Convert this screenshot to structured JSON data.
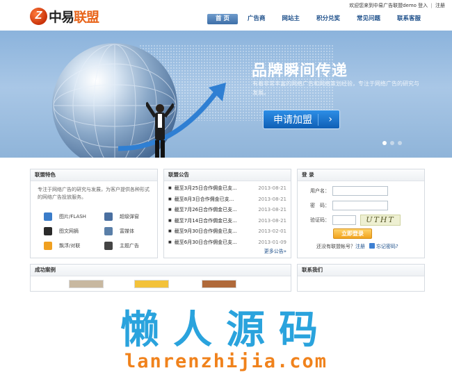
{
  "header": {
    "logo_glyph": "Z",
    "logo_text_black": "中易",
    "logo_text_orange": "联盟",
    "welcome": "欢迎您来到中易广告联盟demo",
    "login_link": "登入",
    "separator": "|",
    "register_link": "注册",
    "nav": [
      "首 页",
      "广告商",
      "网站主",
      "积分兑奖",
      "常见问题",
      "联系客服"
    ],
    "active_nav": 0
  },
  "banner": {
    "title": "品牌瞬间传递",
    "text": "有着非常丰富的网络广告和网络策划经验，专注于网络广告的研究与发展。",
    "button": "申请加盟",
    "button_chevron": "›",
    "slides": 3,
    "active_slide": 0
  },
  "features": {
    "title": "联盟特色",
    "description": "专注于网络广告的研究与发展，为客户提供各种形式的网络广告投放服务。",
    "items": [
      {
        "label": "图片/FLASH",
        "icon": "image-flash-icon",
        "color": "#3a7cc9"
      },
      {
        "label": "超级弹窗",
        "icon": "popup-icon",
        "color": "#4a6fa0"
      },
      {
        "label": "图文网摘",
        "icon": "photo-text-icon",
        "color": "#2a2a2a"
      },
      {
        "label": "富媒体",
        "icon": "rich-media-icon",
        "color": "#5a7fa8"
      },
      {
        "label": "飘浮/对联",
        "icon": "float-couplet-icon",
        "color": "#f0a020"
      },
      {
        "label": "主题广告",
        "icon": "theme-ad-icon",
        "color": "#444444"
      }
    ]
  },
  "notices": {
    "title": "联盟公告",
    "items": [
      {
        "title": "截至3月25日合作佣金已支...",
        "date": "2013-08-21"
      },
      {
        "title": "截至8月3日合作佣金已支...",
        "date": "2013-08-21"
      },
      {
        "title": "截至7月26日合作佣金已支...",
        "date": "2013-08-21"
      },
      {
        "title": "截至7月14日合作佣金已支...",
        "date": "2013-08-21"
      },
      {
        "title": "截至9月30日合作佣金已支...",
        "date": "2013-02-01"
      },
      {
        "title": "截至6月30日合作佣金已支...",
        "date": "2013-01-09"
      }
    ],
    "more": "更多公告»"
  },
  "login": {
    "title": "登 录",
    "username_label": "用户名：",
    "password_label": "密　码：",
    "captcha_label": "验证码：",
    "captcha_text": "UTHT",
    "submit": "立即登录",
    "footer_question": "还没有联盟帐号？",
    "footer_register": "注册",
    "footer_forgot": "忘记密码?"
  },
  "cases": {
    "title": "成功案例"
  },
  "contact": {
    "title": "联系我们"
  },
  "watermark": {
    "cn": "懒人源码",
    "en": "lanrenzhijia.com"
  }
}
